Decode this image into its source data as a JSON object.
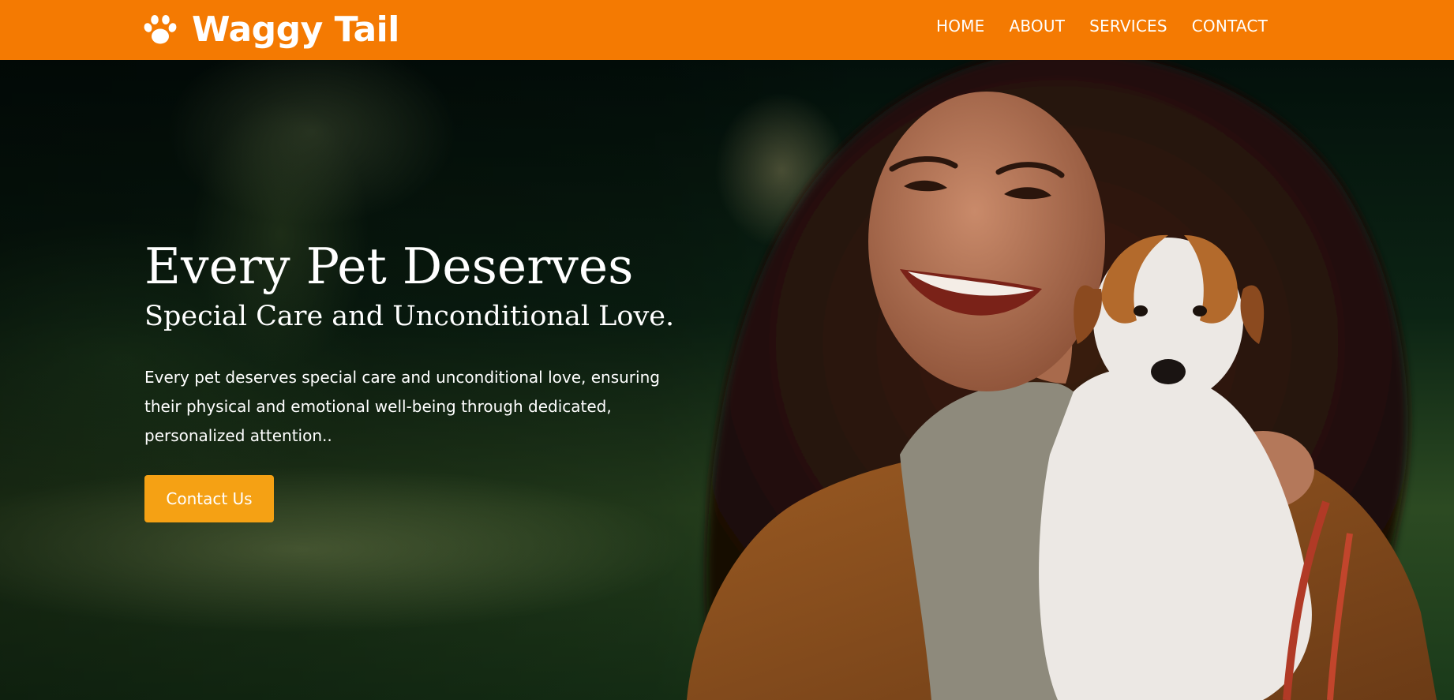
{
  "brand": {
    "name": "Waggy Tail",
    "logo_icon": "paw-icon",
    "color": "#f47a02"
  },
  "nav": {
    "items": [
      {
        "label": "HOME"
      },
      {
        "label": "ABOUT"
      },
      {
        "label": "SERVICES"
      },
      {
        "label": "CONTACT"
      }
    ]
  },
  "hero": {
    "title": "Every Pet Deserves",
    "subtitle": "Special Care and Unconditional Love.",
    "text": "Every pet deserves special care and unconditional love, ensuring their physical and emotional well-being through dedicated, personalized attention..",
    "cta_label": "Contact Us",
    "cta_color": "#f5a114"
  }
}
